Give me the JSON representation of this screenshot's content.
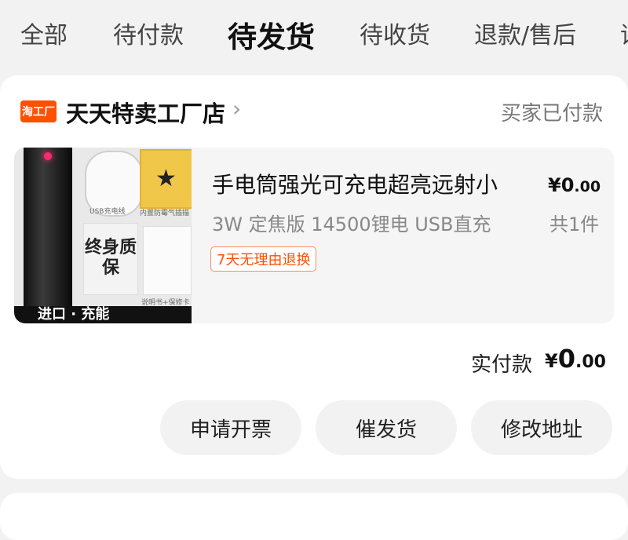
{
  "tabs": [
    "全部",
    "待付款",
    "待发货",
    "待收货",
    "退款/售后",
    "评"
  ],
  "shop": {
    "logo_text": "淘工厂",
    "name": "天天特卖工厂店",
    "chevron": "›",
    "status": "买家已付款"
  },
  "item": {
    "title": "手电筒强光可充电超亮远射小",
    "spec": "3W 定焦版 14500锂电 USB直充",
    "tag": "7天无理由退换",
    "price_main": "¥0",
    "price_decimal": ".00",
    "quantity": "共1件",
    "thumb_texts": {
      "cable": "USB充电线",
      "card": "内置防霉气插描",
      "warranty": "终身质保",
      "manual": "说明书+保修卡",
      "bottom": "进口 · 充能"
    }
  },
  "total": {
    "label": "实付款",
    "yen": "¥",
    "amount_main": "0",
    "amount_decimal": ".00"
  },
  "buttons": {
    "invoice": "申请开票",
    "urge": "催发货",
    "address": "修改地址"
  },
  "colors": {
    "accent": "#ff5000",
    "background": "#f2f2f2",
    "card": "#ffffff"
  }
}
